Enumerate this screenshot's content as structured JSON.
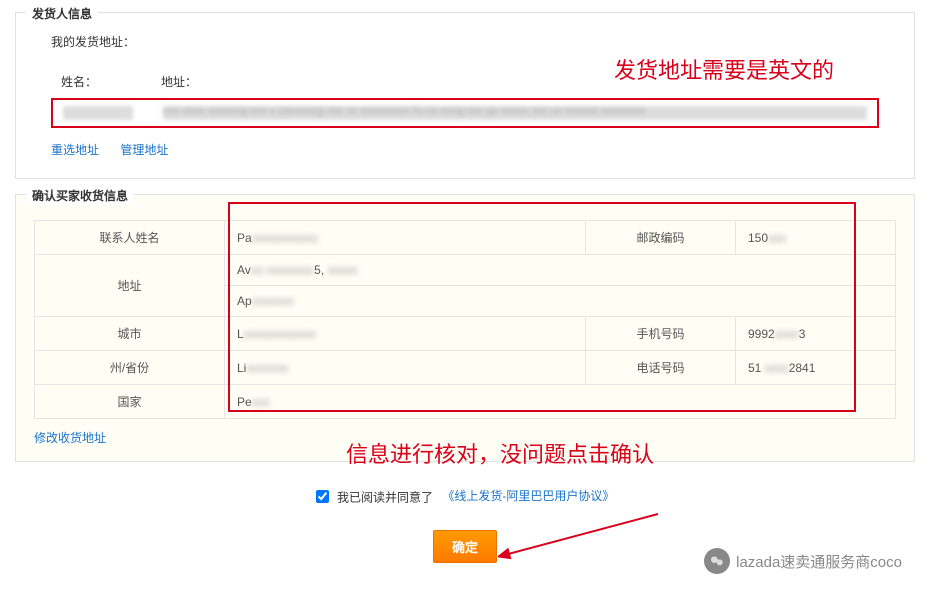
{
  "shipper": {
    "title": "发货人信息",
    "my_address_label": "我的发货地址：",
    "headers": {
      "name": "姓名：",
      "address": "地址："
    },
    "row": {
      "name_blur": "xxxxxxxx",
      "addr_hint": "xxx xxxx xxxxxng sxx x zaxxxxxg xxx xx xxxxxxxxn fu nx xxng xxx gx xxxxx xxx xx xxxxxx xxxxxxxx"
    },
    "links": {
      "reselect": "重选地址",
      "manage": "管理地址"
    },
    "annotation": "发货地址需要是英文的"
  },
  "buyer": {
    "title": "确认买家收货信息",
    "labels": {
      "contact": "联系人姓名",
      "address": "地址",
      "city": "城市",
      "state": "州/省份",
      "country": "国家",
      "zip": "邮政编码",
      "mobile": "手机号码",
      "phone": "电话号码"
    },
    "values": {
      "contact": "Paxxxxxxxxxxx",
      "zip": "150xxx",
      "addr1": "Avxx xxxxxxxx5, xxxxx",
      "addr2": "Apxxxxxxx",
      "city": "Lxxxxxxxxxxxx",
      "mobile": "9992xxxxx3",
      "state": "Lixxxxxxx",
      "phone": "51 xxxxx2841",
      "country": "Pexxx"
    },
    "modify_link": "修改收货地址",
    "annotation": "信息进行核对，没问题点击确认"
  },
  "footer": {
    "agree_text": "我已阅读并同意了",
    "agreement_link": "《线上发货-阿里巴巴用户协议》",
    "confirm_btn": "确定"
  },
  "watermark": {
    "text": "lazada速卖通服务商coco"
  }
}
